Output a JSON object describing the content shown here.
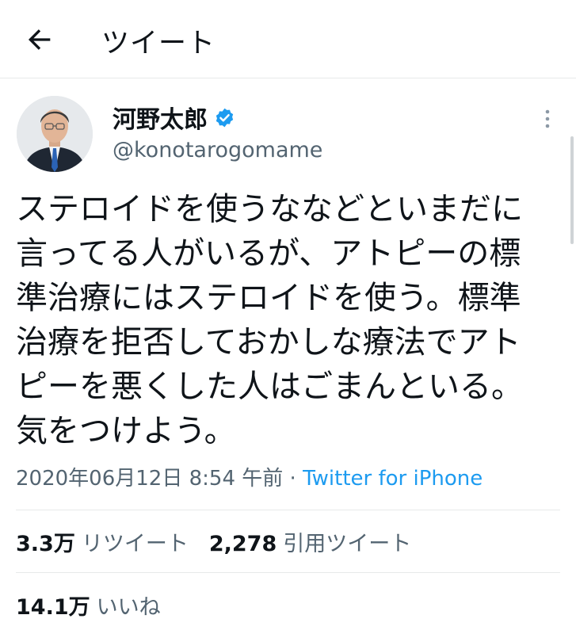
{
  "header": {
    "title": "ツイート",
    "back_icon": "arrow-left-icon"
  },
  "author": {
    "display_name": "河野太郎",
    "handle": "@konotarogomame",
    "verified_icon": "verified-badge-icon",
    "verified_color": "#1d9bf0"
  },
  "tweet": {
    "text": "ステロイドを使うななどといまだに\n言ってる人がいるが、アトピーの標\n準治療にはステロイドを使う。標準\n治療を拒否しておかしな療法でアト\nピーを悪くした人はごまんといる。\n気をつけよう。",
    "timestamp": "2020年06月12日 8:54 午前",
    "separator": " · ",
    "source": "Twitter for iPhone"
  },
  "stats": {
    "retweets_count": "3.3万",
    "retweets_label": "リツイート",
    "quotes_count": "2,278",
    "quotes_label": "引用ツイート",
    "likes_count": "14.1万",
    "likes_label": "いいね"
  },
  "colors": {
    "accent": "#1d9bf0",
    "secondary_text": "#536471",
    "divider": "#e7e9ea"
  }
}
